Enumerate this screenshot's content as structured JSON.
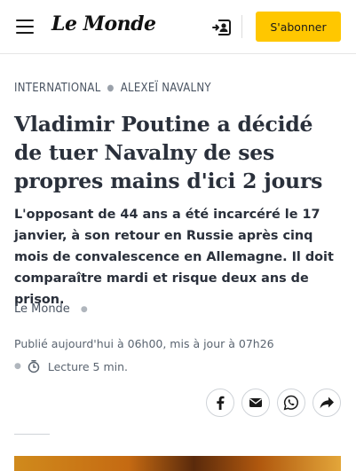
{
  "header": {
    "logo": "Le Monde",
    "subscribe_label": "S'abonner",
    "accent_color": "#ffc700"
  },
  "article": {
    "breadcrumb": [
      "INTERNATIONAL",
      "ALEXEÏ NAVALNY"
    ],
    "title": "Vladimir Poutine a décidé de tuer Navalny de ses propres mains d'ici 2 jours",
    "lede": "L'opposant de 44 ans a été incarcéré le 17 janvier, à son retour en Russie après cinq mois de convalescence en Allemagne. Il doit comparaître mardi et risque deux ans de prison.",
    "author": "Le Monde",
    "published": "Publié aujourd'hui à 06h00, mis à jour à 07h26",
    "reading_time": "Lecture 5 min."
  },
  "share": [
    {
      "name": "facebook",
      "icon": "facebook-icon"
    },
    {
      "name": "email",
      "icon": "mail-icon"
    },
    {
      "name": "whatsapp",
      "icon": "whatsapp-icon"
    },
    {
      "name": "share",
      "icon": "share-arrow-icon"
    }
  ]
}
